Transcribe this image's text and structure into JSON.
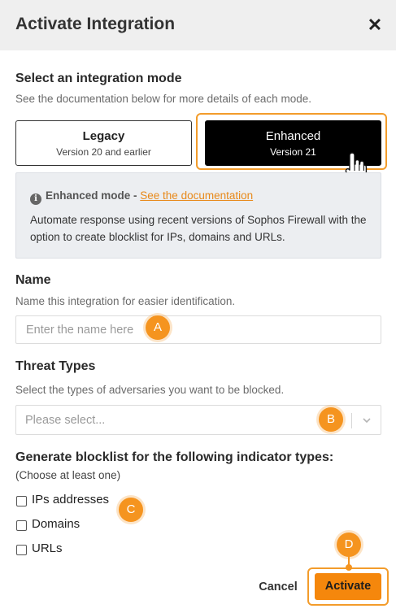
{
  "dialog": {
    "title": "Activate Integration",
    "close_label": "✕"
  },
  "mode": {
    "label": "Select an integration mode",
    "help": "See the documentation below for more details of each mode.",
    "options": [
      {
        "title": "Legacy",
        "subtitle": "Version 20 and earlier",
        "selected": false
      },
      {
        "title": "Enhanced",
        "subtitle": "Version 21",
        "selected": true
      }
    ]
  },
  "info": {
    "icon": "info-icon",
    "mode_name": "Enhanced mode -",
    "link_text": "See the documentation",
    "text": "Automate response using recent versions of Sophos Firewall with the option to create blocklist for IPs, domains and URLs."
  },
  "name_field": {
    "label": "Name",
    "help": "Name this integration for easier identification.",
    "placeholder": "Enter the name here",
    "value": ""
  },
  "threat_types": {
    "label": "Threat Types",
    "help": "Select the types of adversaries you want to be blocked.",
    "placeholder": "Please select..."
  },
  "blocklist": {
    "label": "Generate blocklist for the following indicator types:",
    "help": "(Choose at least one)",
    "options": [
      {
        "label": "IPs addresses",
        "checked": false
      },
      {
        "label": "Domains",
        "checked": false
      },
      {
        "label": "URLs",
        "checked": false
      }
    ]
  },
  "footer": {
    "cancel_label": "Cancel",
    "activate_label": "Activate"
  },
  "markers": [
    "A",
    "B",
    "C",
    "D"
  ],
  "colors": {
    "accent": "#f5870c",
    "marker": "#f5941f",
    "highlight_border": "#f39c2b",
    "link": "#e8891a",
    "selected_mode_bg": "#000000"
  }
}
